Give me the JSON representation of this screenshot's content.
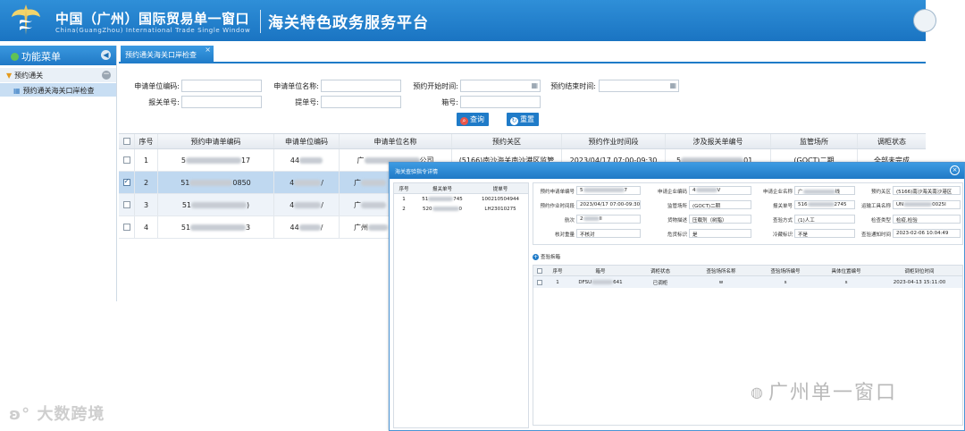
{
  "header": {
    "title_main": "中国（广州）国际贸易单一窗口",
    "title_sub": "China(GuangZhou) International Trade Single Window",
    "platform": "海关特色政务服务平台"
  },
  "sidebar": {
    "title": "功能菜单",
    "group": "预约通关",
    "item": "预约通关海关口岸检查"
  },
  "tab": {
    "label": "预约通关海关口岸检查",
    "close": "×"
  },
  "search": {
    "applicant_code_label": "申请单位编码:",
    "applicant_name_label": "申请单位名称:",
    "start_time_label": "预约开始时间:",
    "end_time_label": "预约结束时间:",
    "declaration_no_label": "报关单号:",
    "bill_no_label": "提单号:",
    "container_no_label": "箱号:",
    "query_button": "查询",
    "reset_button": "重置"
  },
  "grid": {
    "columns": [
      "序号",
      "预约申请单编码",
      "申请单位编码",
      "申请单位名称",
      "预约关区",
      "预约作业时间段",
      "涉及报关单编号",
      "监管场所",
      "调柜状态"
    ],
    "rows": [
      {
        "no": "1",
        "code_a": "5",
        "code_b": "17",
        "unit_a": "44",
        "unit_b": "",
        "name_a": "广",
        "name_b": "公司",
        "area": "(5166)南沙海关南沙港区监管",
        "time": "2023/04/17 07:00-09:30",
        "decl_a": "5",
        "decl_b": "01...",
        "place": "(GOCT)二期",
        "status": "全部未完成"
      },
      {
        "no": "2",
        "code_a": "51",
        "code_b": "0850",
        "unit_a": "4",
        "unit_b": "/",
        "name_a": "广",
        "name_b": "",
        "area": "",
        "time": "",
        "decl_a": "",
        "decl_b": "",
        "place": "",
        "status": ""
      },
      {
        "no": "3",
        "code_a": "51",
        "code_b": ")",
        "unit_a": "4",
        "unit_b": "/",
        "name_a": "广",
        "name_b": "",
        "area": "",
        "time": "",
        "decl_a": "",
        "decl_b": "",
        "place": "",
        "status": ""
      },
      {
        "no": "4",
        "code_a": "51",
        "code_b": "3",
        "unit_a": "44",
        "unit_b": "/",
        "name_a": "广州",
        "name_b": "",
        "area": "",
        "time": "",
        "decl_a": "",
        "decl_b": "",
        "place": "",
        "status": ""
      }
    ]
  },
  "modal": {
    "title": "海关查验指令详情",
    "close": "×",
    "mini_table": {
      "columns": [
        "序号",
        "报关单号",
        "提单号"
      ],
      "rows": [
        {
          "no": "1",
          "decl_a": "51",
          "decl_b": "745",
          "bill": "100210504944"
        },
        {
          "no": "2",
          "decl_a": "520",
          "decl_b": "0",
          "bill": "LH23010275"
        }
      ]
    },
    "info": {
      "app_no_label": "预约申请单编号",
      "app_no_a": "5",
      "app_no_b": "7",
      "ent_code_label": "申请企业编码",
      "ent_code_a": "4",
      "ent_code_b": "V",
      "ent_name_label": "申请企业名称",
      "ent_name_a": "广",
      "ent_name_b": "线",
      "area_label": "预约关区",
      "area": "(5166)南沙海关南沙港区",
      "op_time_label": "预约作业时间段",
      "op_time": "2023/04/17 07:00-09:30",
      "place_label": "监管场所",
      "place": "(GOCT)二期",
      "decl_label": "报关单号",
      "decl_a": "516",
      "decl_b": "2745",
      "vehicle_label": "运输工具名称",
      "vehicle_a": "UN",
      "vehicle_b": "0025I",
      "voyage_label": "航次",
      "voyage_a": "2",
      "voyage_b": "II",
      "goods_label": "货物描述",
      "goods": "压载剂（树脂）",
      "method_label": "查验方式",
      "method": "(1)人工",
      "type_label": "检查类型",
      "type": "检疫,检验",
      "weigh_label": "核对重量",
      "weigh": "不核对",
      "hazard_label": "危货标识",
      "hazard": "是",
      "cold_label": "冷藏标识",
      "cold": "不是",
      "notice_label": "查验通知时间",
      "notice": "2023-02-06 10:04:49"
    },
    "check_button": "查验拆箱",
    "check_table": {
      "columns": [
        "序号",
        "箱号",
        "调柜状态",
        "查验场所名称",
        "查验场所编号",
        "具体位置编号",
        "调柜到位时间"
      ],
      "rows": [
        {
          "no": "1",
          "box_a": "DFSU",
          "box_b": "641",
          "status": "已调柜",
          "place_name": "w",
          "place_no": "s",
          "pos_no": "s",
          "time": "2023-04-13 15:11:00"
        }
      ]
    }
  },
  "watermarks": {
    "left": "大数跨境",
    "right": "广州单一窗口"
  },
  "colors": {
    "header_blue": "#1f7bc8",
    "selected_row": "#bfd8f0",
    "watermark_gray": "#b9b9b9"
  }
}
